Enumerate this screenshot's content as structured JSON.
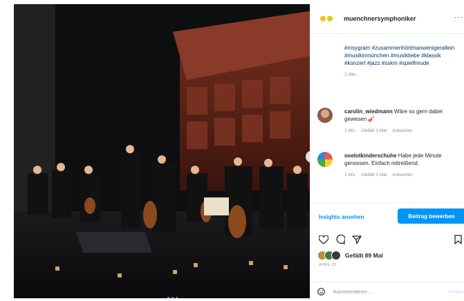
{
  "post": {
    "image_alt": "Orchestra on stage with conductor",
    "carousel_dots": 3,
    "active_dot": 0
  },
  "header": {
    "username": "muenchnersymphoniker",
    "more_label": "···"
  },
  "caption": {
    "hashtags": "#msygram #zusammenhörtmanwenigerallein #musikinmünchen #musikliebe #klassik #konzert #jazz #sskm #spielfreude",
    "time": "1 Wo."
  },
  "comments": [
    {
      "username": "carolin_wiedmann",
      "text": " Wäre so gern dabei gewesen 🎻",
      "time": "1 Wo.",
      "likes": "Gefällt 1 Mal",
      "reply": "Antworten"
    },
    {
      "username": "oselotkinderschuhe",
      "text": " Habe jede Minute genossen. Einfach mitreißend.",
      "time": "1 Wo.",
      "likes": "Gefällt 2 Mal",
      "reply": "Antworten"
    }
  ],
  "actions": {
    "insights": "Insights ansehen",
    "promote": "Beitrag bewerben"
  },
  "likes": {
    "text": "Gefällt 89 Mal"
  },
  "date": "APRIL 23",
  "comment_box": {
    "placeholder": "Kommentieren ...",
    "post": "Posten"
  },
  "colors": {
    "accent": "#0095f6",
    "hashtag": "#00376b",
    "muted": "#8e8e8e"
  }
}
